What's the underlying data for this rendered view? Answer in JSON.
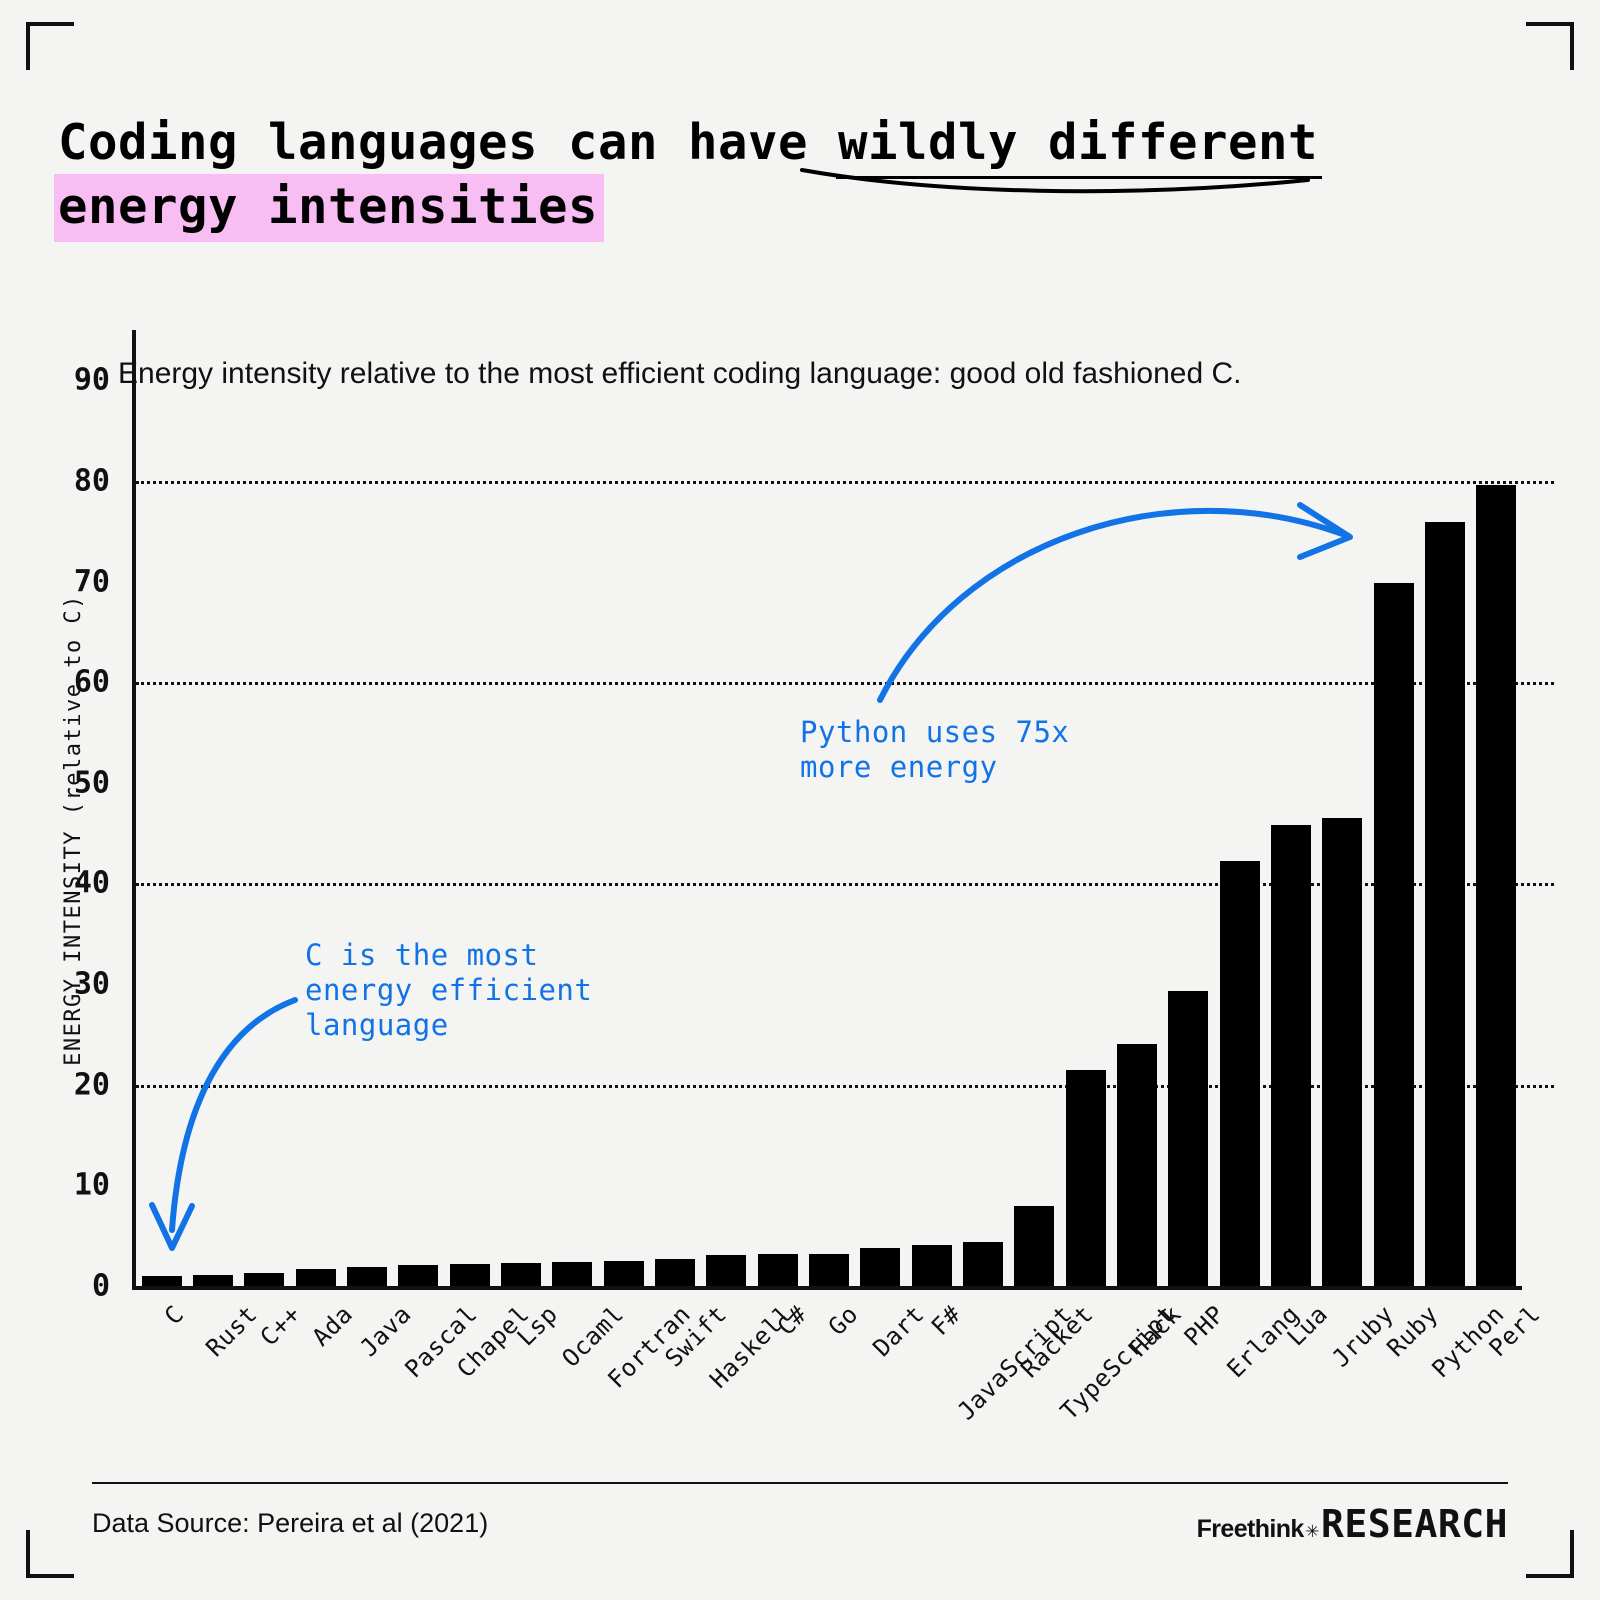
{
  "title": {
    "line1_a": "Coding languages can have ",
    "line1_b": "wildly different",
    "line2": "energy intensities"
  },
  "subtitle": "Energy intensity relative to the most efficient coding language: good old fashioned C.",
  "annotations": {
    "left": "C is the most\nenergy efficient\nlanguage",
    "right": "Python uses 75x\nmore energy",
    "color": "#1273e6"
  },
  "footer": {
    "source": "Data Source: Pereira et al (2021)",
    "brand_1": "Freethink",
    "brand_star": "✳",
    "brand_2": "RESEARCH"
  },
  "chart_data": {
    "type": "bar",
    "title": "Coding languages can have wildly different energy intensities",
    "subtitle": "Energy intensity relative to the most efficient coding language: good old fashioned C.",
    "xlabel": "",
    "ylabel": "ENERGY INTENSITY (relative to C)",
    "ylim": [
      0,
      95
    ],
    "yticks": [
      0,
      10,
      20,
      30,
      40,
      50,
      60,
      70,
      80,
      90
    ],
    "gridlines": [
      20,
      40,
      60,
      80
    ],
    "grid": true,
    "legend": "none",
    "bar_color": "#000000",
    "categories": [
      "C",
      "Rust",
      "C++",
      "Ada",
      "Java",
      "Pascal",
      "Chapel",
      "Lsp",
      "Ocaml",
      "Fortran",
      "Swift",
      "Haskell",
      "C#",
      "Go",
      "Dart",
      "F#",
      "JavaScript",
      "Racket",
      "TypeScript",
      "Hack",
      "PHP",
      "Erlang",
      "Lua",
      "Jruby",
      "Ruby",
      "Python",
      "Perl"
    ],
    "values": [
      1.0,
      1.1,
      1.3,
      1.7,
      1.9,
      2.1,
      2.2,
      2.3,
      2.4,
      2.5,
      2.7,
      3.1,
      3.2,
      3.2,
      3.8,
      4.1,
      4.4,
      8.0,
      21.5,
      24.0,
      29.3,
      42.2,
      45.8,
      46.5,
      69.9,
      75.9,
      79.6
    ]
  }
}
